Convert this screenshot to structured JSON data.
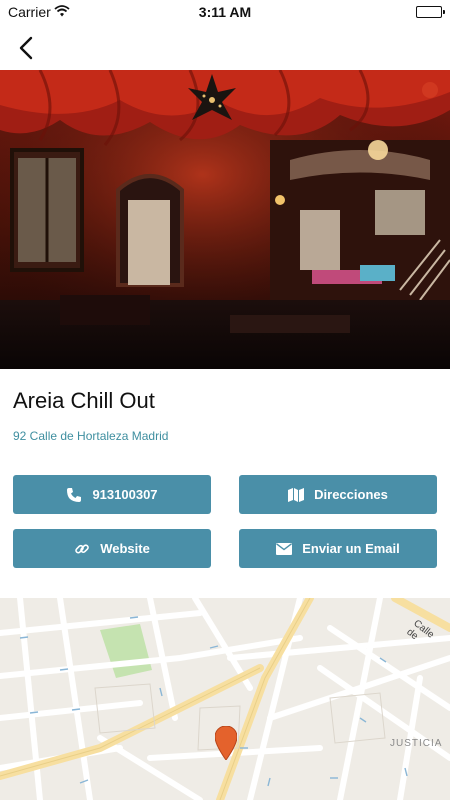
{
  "status_bar": {
    "carrier": "Carrier",
    "time": "3:11 AM"
  },
  "nav": {
    "back_icon": "chevron-left-icon"
  },
  "venue": {
    "name": "Areia Chill Out",
    "address": "92 Calle de Hortaleza Madrid"
  },
  "actions": {
    "phone_label": "913100307",
    "directions_label": "Direcciones",
    "website_label": "Website",
    "email_label": "Enviar un Email"
  },
  "map": {
    "label_street": "Calle de",
    "label_district": "JUSTICIA"
  },
  "colors": {
    "button": "#4a8fa8",
    "address_link": "#3f8fa0",
    "map_road_major": "#f7dfa0",
    "map_pin": "#e4622c",
    "map_park": "#c5e3b0"
  }
}
